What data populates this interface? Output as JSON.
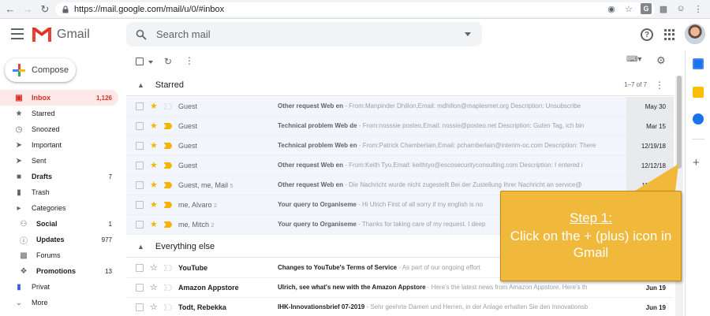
{
  "browser": {
    "url": "https://mail.google.com/mail/u/0/#inbox"
  },
  "header": {
    "app_name": "Gmail",
    "search_placeholder": "Search mail"
  },
  "sidebar": {
    "compose_label": "Compose",
    "items": [
      {
        "label": "Inbox",
        "count": "1,126",
        "icon": "inbox-icon"
      },
      {
        "label": "Starred",
        "count": "",
        "icon": "star-icon"
      },
      {
        "label": "Snoozed",
        "count": "",
        "icon": "clock-icon"
      },
      {
        "label": "Important",
        "count": "",
        "icon": "important-icon"
      },
      {
        "label": "Sent",
        "count": "",
        "icon": "send-icon"
      },
      {
        "label": "Drafts",
        "count": "7",
        "icon": "draft-icon"
      },
      {
        "label": "Trash",
        "count": "",
        "icon": "trash-icon"
      },
      {
        "label": "Categories",
        "count": "",
        "icon": "label-icon"
      },
      {
        "label": "Social",
        "count": "1",
        "icon": "people-icon"
      },
      {
        "label": "Updates",
        "count": "977",
        "icon": "info-icon"
      },
      {
        "label": "Forums",
        "count": "",
        "icon": "forum-icon"
      },
      {
        "label": "Promotions",
        "count": "13",
        "icon": "tag-icon"
      },
      {
        "label": "Privat",
        "count": "",
        "icon": "label-icon"
      },
      {
        "label": "More",
        "count": "",
        "icon": "chevron-down-icon"
      }
    ]
  },
  "starred": {
    "title": "Starred",
    "count": "1–7 of 7",
    "rows": [
      {
        "sender": "Guest",
        "cnt": "",
        "subject": "Other request Web en",
        "snippet": " - From:Manpinder Dhillon,Email: mdhillon@maplesmet.org Description: Unsubscribe",
        "date": "May 30"
      },
      {
        "sender": "Guest",
        "cnt": "",
        "subject": "Technical problem Web de",
        "snippet": " - From:nosssie posteo,Email: nossie@posteo.net Description: Guten Tag, ich bin",
        "date": "Mar 15"
      },
      {
        "sender": "Guest",
        "cnt": "",
        "subject": "Technical problem Web en",
        "snippet": " - From:Patrick Chamberlain,Email: pchamberlain@interim-oc.com Description: There",
        "date": "12/19/18"
      },
      {
        "sender": "Guest",
        "cnt": "",
        "subject": "Other request Web en",
        "snippet": " - From:Keith Tyo,Email: keithtyo@escosecurityconsulting.com Description: I entered i",
        "date": "12/12/18"
      },
      {
        "sender": "Guest, me, Mail",
        "cnt": "5",
        "subject": "Other request Web en",
        "snippet": " - Die Nachricht wurde nicht zugestellt Bei der Zustellung Ihrer Nachricht an service@",
        "date": "11/30/18"
      },
      {
        "sender": "me, Alvaro",
        "cnt": "2",
        "subject": "Your query to Organiseme",
        "snippet": " - Hi Ulrich First of all sorry if my english is no",
        "date": ""
      },
      {
        "sender": "me, Mitch",
        "cnt": "2",
        "subject": "Your query to Organiseme",
        "snippet": " - Thanks for taking care of my request. I deep",
        "date": ""
      }
    ]
  },
  "everything_else": {
    "title": "Everything else",
    "rows": [
      {
        "sender": "YouTube",
        "cnt": "",
        "subject": "Changes to YouTube's Terms of Service",
        "snippet": " - As part of our ongoing effort",
        "date": ""
      },
      {
        "sender": "Amazon Appstore",
        "cnt": "",
        "subject": "Ulrich, see what's new with the Amazon Appstore",
        "snippet": " - Here's the latest news from Amazon Appstore. Here's th",
        "date": "Jun 19"
      },
      {
        "sender": "Todt, Rebekka",
        "cnt": "",
        "subject": "IHK-Innovationsbrief 07-2019",
        "snippet": " - Sehr geehrte Damen und Herren, in der Anlage erhalten Sie den Innovationsb",
        "date": "Jun 19"
      }
    ]
  },
  "callout": {
    "title": "Step 1:",
    "text": "Click on the + (plus) icon in Gmail"
  },
  "colors": {
    "gmail_red": "#d93025",
    "star_yellow": "#f4b400",
    "callout_bg": "#f0b93c"
  }
}
